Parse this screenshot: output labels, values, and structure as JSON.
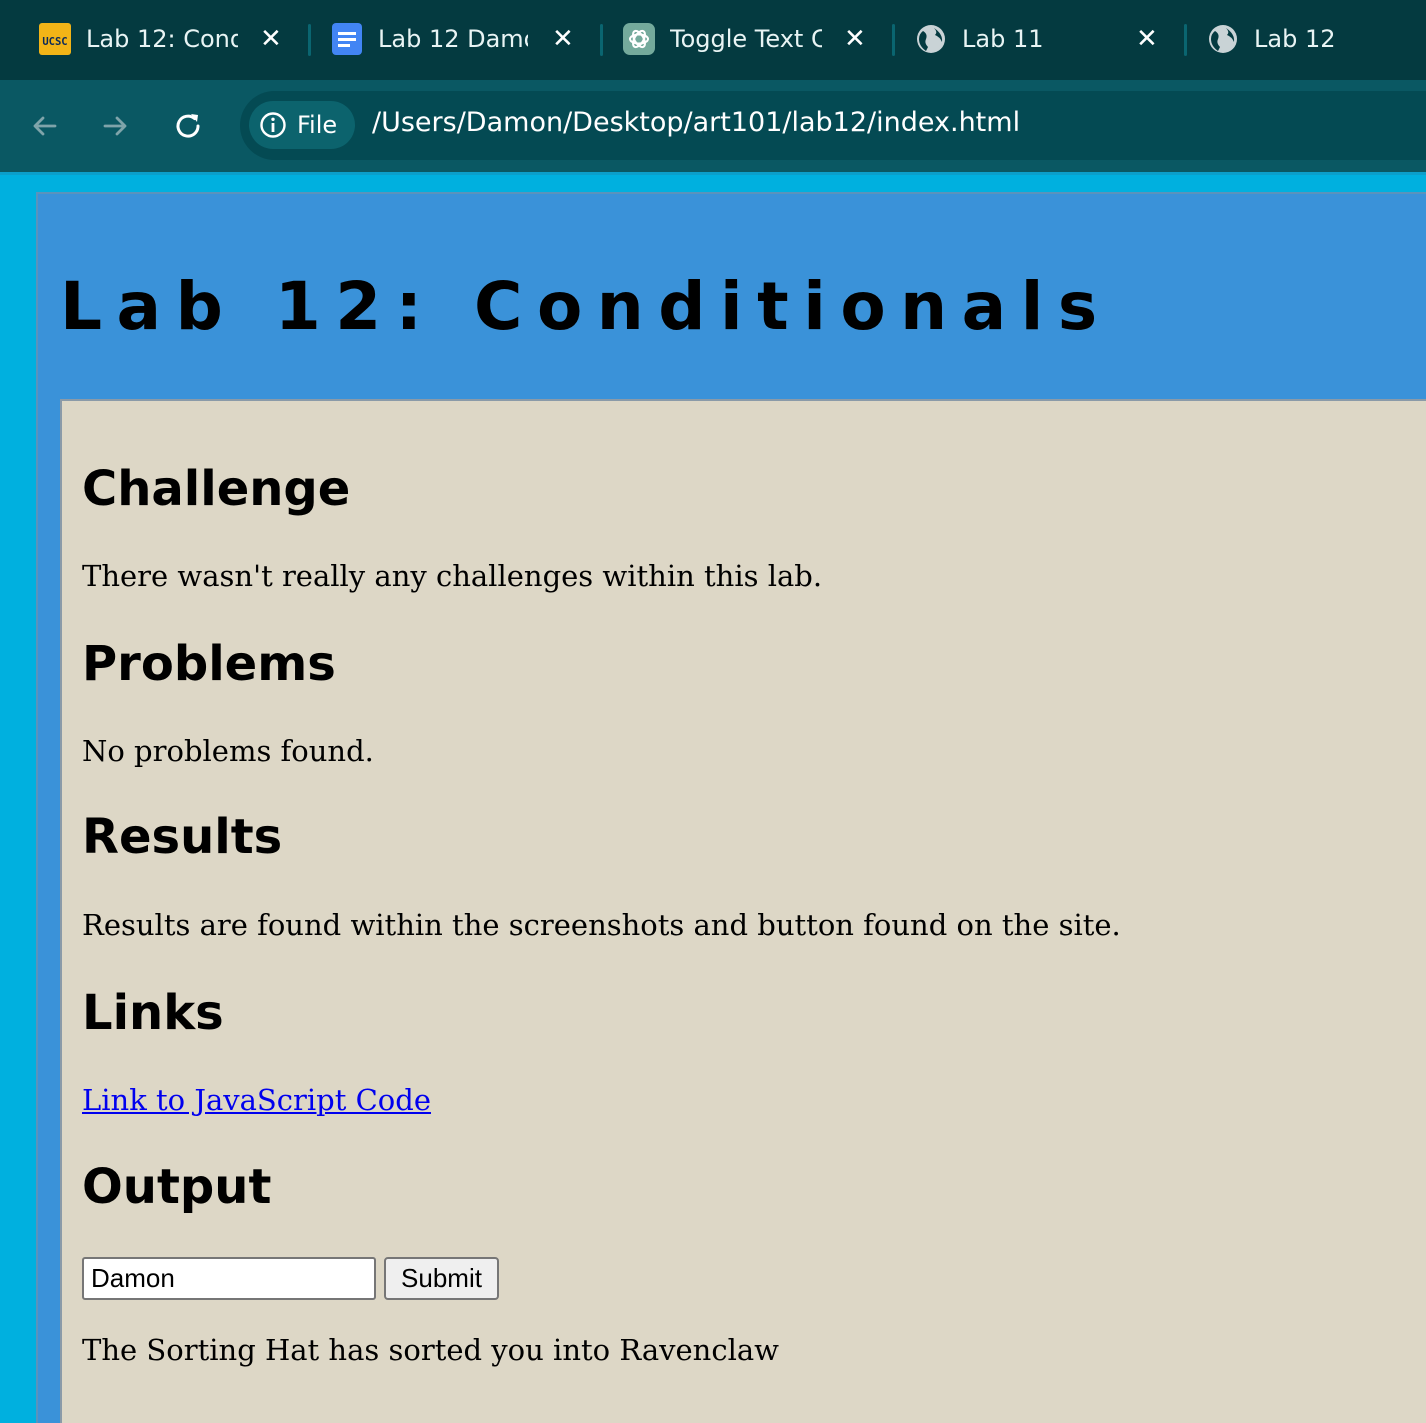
{
  "browser": {
    "tabs": [
      {
        "title": "Lab 12: Cond",
        "favicon": "ucsc-logo-icon",
        "closable": true
      },
      {
        "title": "Lab 12 Damo",
        "favicon": "google-docs-icon",
        "closable": true
      },
      {
        "title": "Toggle Text C",
        "favicon": "chatgpt-icon",
        "closable": true
      },
      {
        "title": "Lab 11",
        "favicon": "globe-icon",
        "closable": true
      },
      {
        "title": "Lab 12",
        "favicon": "globe-icon",
        "closable": false
      }
    ],
    "favicon_text": "UCSC",
    "toolbar": {
      "back_icon": "arrow-left-icon",
      "forward_icon": "arrow-right-icon",
      "reload_icon": "reload-icon",
      "site_info_label": "File",
      "url": "/Users/Damon/Desktop/art101/lab12/index.html"
    },
    "colors": {
      "tabstrip": "#043a40",
      "toolbar": "#0a5863",
      "page_background": "#00b0df",
      "header_background": "#3a92d9",
      "content_background": "#ddd7c6",
      "link": "#0000ee"
    }
  },
  "page": {
    "title": "Lab 12: Conditionals",
    "sections": {
      "challenge": {
        "heading": "Challenge",
        "text": "There wasn't really any challenges within this lab."
      },
      "problems": {
        "heading": "Problems",
        "text": "No problems found."
      },
      "results": {
        "heading": "Results",
        "text": "Results are found within the screenshots and button found on the site."
      },
      "links": {
        "heading": "Links",
        "link_text": "Link to JavaScript Code"
      },
      "output": {
        "heading": "Output",
        "input_value": "Damon",
        "submit_label": "Submit",
        "result_text": "The Sorting Hat has sorted you into Ravenclaw"
      }
    }
  }
}
